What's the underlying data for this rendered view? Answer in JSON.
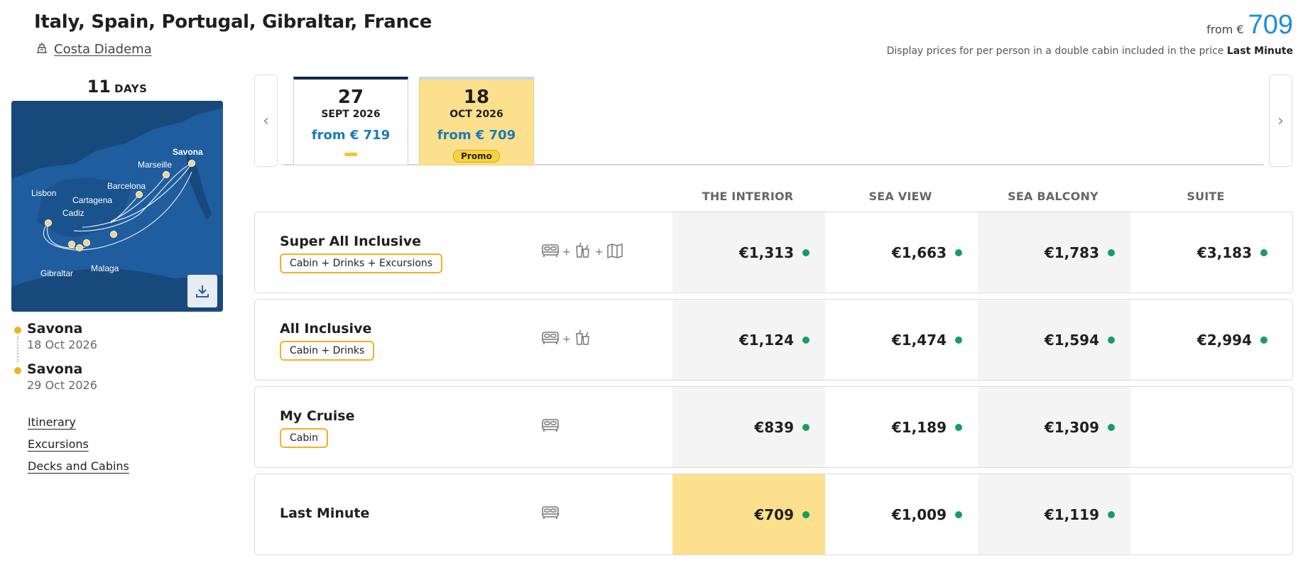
{
  "header": {
    "title": "Italy, Spain, Portugal, Gibraltar, France",
    "ship": "Costa Diadema",
    "price_from_label": "from €",
    "price_from_value": "709",
    "price_note": "Display prices for per person in a double cabin included in the price",
    "price_note_bold": "Last Minute"
  },
  "left": {
    "days_num": "11",
    "days_label": "DAYS",
    "map_labels": [
      "Savona",
      "Marseille",
      "Barcelona",
      "Lisbon",
      "Cartagena",
      "Cadiz",
      "Gibraltar",
      "Malaga"
    ],
    "stops": [
      {
        "name": "Savona",
        "date": "18 Oct 2026"
      },
      {
        "name": "Savona",
        "date": "29 Oct 2026"
      }
    ],
    "links": [
      "Itinerary",
      "Excursions",
      "Decks and Cabins"
    ]
  },
  "dates": [
    {
      "day": "27",
      "month": "SEPT 2026",
      "price": "from € 719",
      "badge": ""
    },
    {
      "day": "18",
      "month": "OCT 2026",
      "price": "from € 709",
      "badge": "Promo"
    }
  ],
  "columns": [
    "THE INTERIOR",
    "SEA VIEW",
    "SEA BALCONY",
    "SUITE"
  ],
  "rows": [
    {
      "name": "Super All Inclusive",
      "badge": "Cabin + Drinks + Excursions",
      "prices": [
        "€1,313",
        "€1,663",
        "€1,783",
        "€3,183"
      ]
    },
    {
      "name": "All Inclusive",
      "badge": "Cabin + Drinks",
      "prices": [
        "€1,124",
        "€1,474",
        "€1,594",
        "€2,994"
      ]
    },
    {
      "name": "My Cruise",
      "badge": "Cabin",
      "prices": [
        "€839",
        "€1,189",
        "€1,309",
        ""
      ]
    },
    {
      "name": "Last Minute",
      "badge": "",
      "prices": [
        "€709",
        "€1,009",
        "€1,119",
        ""
      ]
    }
  ],
  "icons": {
    "plus": "+"
  },
  "colors": {
    "accent_blue": "#1a8fd6",
    "highlight_yellow": "#fde08d",
    "badge_border": "#f2b21f",
    "available_green": "#12a05c"
  }
}
